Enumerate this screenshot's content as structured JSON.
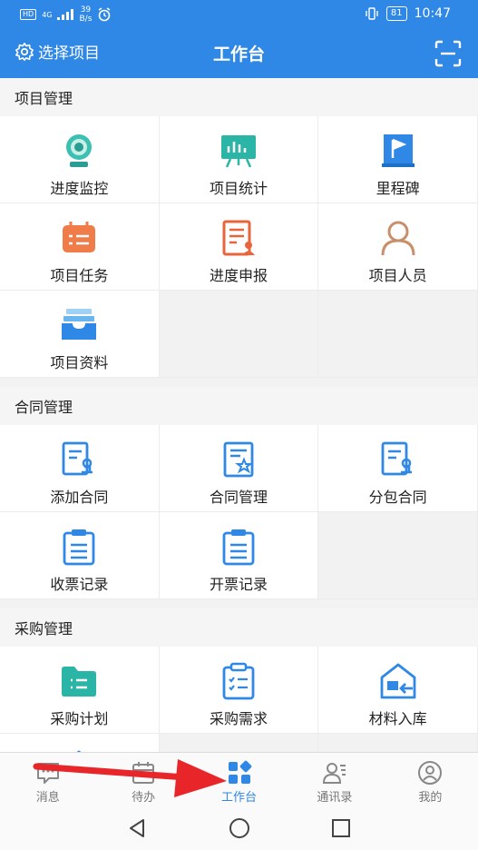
{
  "status_bar": {
    "hd": "HD",
    "network": "4G",
    "speed_value": "39",
    "speed_unit": "B/s",
    "battery": "81",
    "time": "10:47"
  },
  "header": {
    "select_project": "选择项目",
    "title": "工作台"
  },
  "sections": [
    {
      "title": "项目管理",
      "items": [
        {
          "label": "进度监控",
          "icon": "camera-icon"
        },
        {
          "label": "项目统计",
          "icon": "chart-board-icon"
        },
        {
          "label": "里程碑",
          "icon": "flag-icon"
        },
        {
          "label": "项目任务",
          "icon": "calendar-icon"
        },
        {
          "label": "进度申报",
          "icon": "report-icon"
        },
        {
          "label": "项目人员",
          "icon": "person-icon"
        },
        {
          "label": "项目资料",
          "icon": "tray-icon"
        }
      ]
    },
    {
      "title": "合同管理",
      "items": [
        {
          "label": "添加合同",
          "icon": "contract-stamp-icon"
        },
        {
          "label": "合同管理",
          "icon": "contract-star-icon"
        },
        {
          "label": "分包合同",
          "icon": "contract-stamp-icon"
        },
        {
          "label": "收票记录",
          "icon": "clipboard-icon"
        },
        {
          "label": "开票记录",
          "icon": "clipboard-icon"
        }
      ]
    },
    {
      "title": "采购管理",
      "items": [
        {
          "label": "采购计划",
          "icon": "folder-icon"
        },
        {
          "label": "采购需求",
          "icon": "checklist-icon"
        },
        {
          "label": "材料入库",
          "icon": "warehouse-icon"
        }
      ]
    }
  ],
  "tabbar": {
    "tabs": [
      {
        "label": "消息",
        "icon": "message-icon"
      },
      {
        "label": "待办",
        "icon": "todo-icon"
      },
      {
        "label": "工作台",
        "icon": "workbench-icon"
      },
      {
        "label": "通讯录",
        "icon": "contacts-icon"
      },
      {
        "label": "我的",
        "icon": "profile-icon"
      }
    ],
    "active_index": 2
  },
  "colors": {
    "primary": "#2f87e6",
    "teal": "#2bb5a7",
    "orange": "#f07c4a",
    "arrow": "#e8262a"
  }
}
